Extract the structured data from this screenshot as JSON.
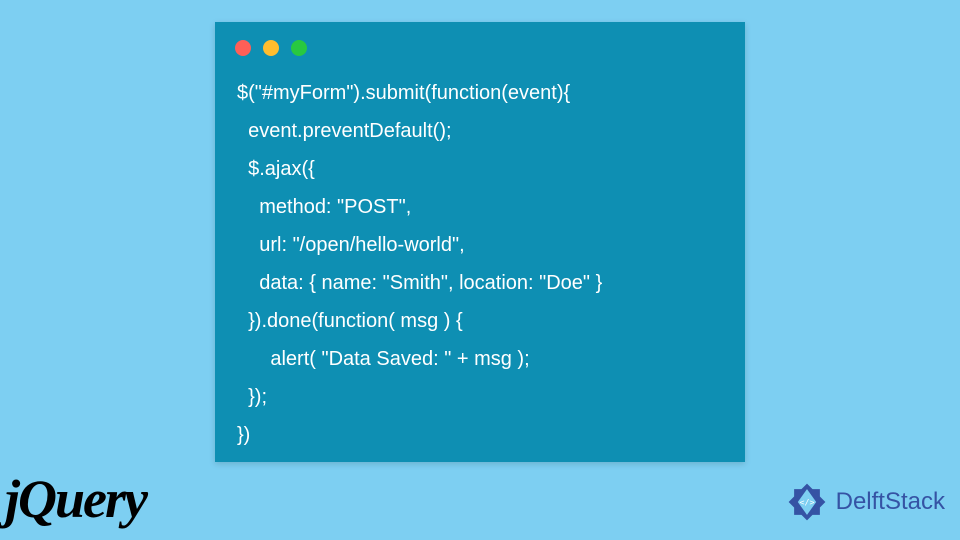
{
  "code": {
    "lines": [
      "$(\"#myForm\").submit(function(event){",
      "  event.preventDefault();",
      "  $.ajax({",
      "    method: \"POST\",",
      "    url: \"/open/hello-world\",",
      "    data: { name: \"Smith\", location: \"Doe\" }",
      "  }).done(function( msg ) {",
      "      alert( \"Data Saved: \" + msg );",
      "  });",
      "})"
    ]
  },
  "logos": {
    "jquery": "jQuery",
    "delftstack": "DelftStack"
  }
}
